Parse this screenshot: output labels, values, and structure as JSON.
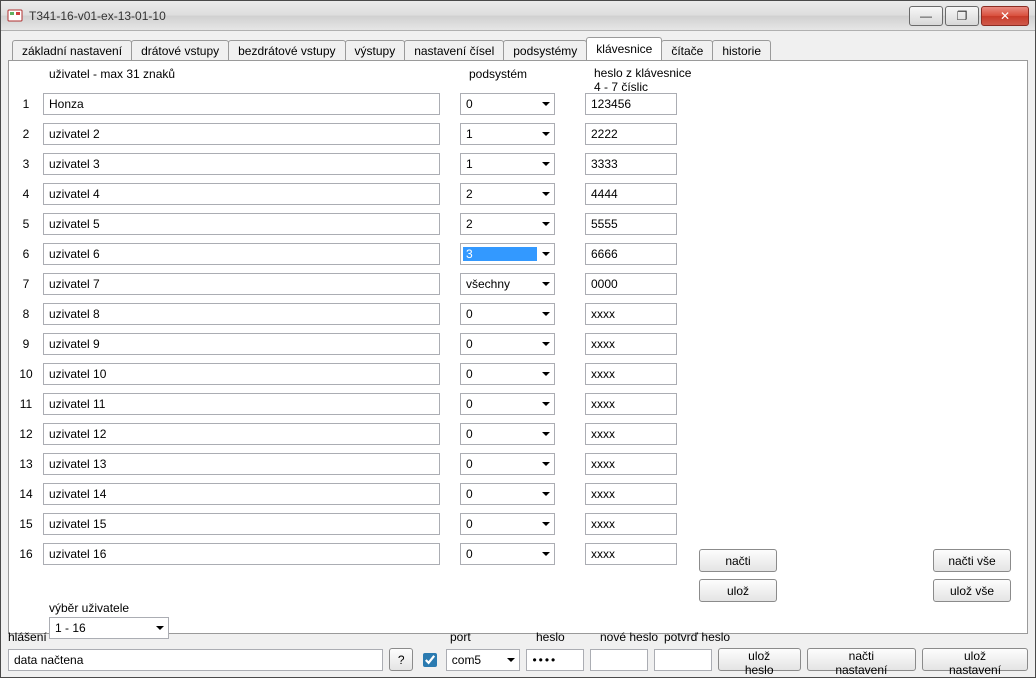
{
  "window": {
    "title": "T341-16-v01-ex-13-01-10"
  },
  "winbuttons": {
    "min": "—",
    "max": "❐",
    "close": "✕"
  },
  "tabs": [
    "základní nastavení",
    "drátové vstupy",
    "bezdrátové vstupy",
    "výstupy",
    "nastavení čísel",
    "podsystémy",
    "klávesnice",
    "čítače",
    "historie"
  ],
  "active_tab_index": 6,
  "headers": {
    "user": "uživatel - max 31 znaků",
    "subsystem": "podsystém",
    "password_line1": "heslo z klávesnice",
    "password_line2": "4 - 7 číslic"
  },
  "rows": [
    {
      "n": "1",
      "user": "Honza",
      "sub": "0",
      "sub_selected": false,
      "pass": "123456"
    },
    {
      "n": "2",
      "user": "uzivatel 2",
      "sub": "1",
      "sub_selected": false,
      "pass": "2222"
    },
    {
      "n": "3",
      "user": "uzivatel 3",
      "sub": "1",
      "sub_selected": false,
      "pass": "3333"
    },
    {
      "n": "4",
      "user": "uzivatel 4",
      "sub": "2",
      "sub_selected": false,
      "pass": "4444"
    },
    {
      "n": "5",
      "user": "uzivatel 5",
      "sub": "2",
      "sub_selected": false,
      "pass": "5555"
    },
    {
      "n": "6",
      "user": "uzivatel 6",
      "sub": "3",
      "sub_selected": true,
      "pass": "6666"
    },
    {
      "n": "7",
      "user": "uzivatel 7",
      "sub": "všechny",
      "sub_selected": false,
      "pass": "0000"
    },
    {
      "n": "8",
      "user": "uzivatel 8",
      "sub": "0",
      "sub_selected": false,
      "pass": "xxxx"
    },
    {
      "n": "9",
      "user": "uzivatel 9",
      "sub": "0",
      "sub_selected": false,
      "pass": "xxxx"
    },
    {
      "n": "10",
      "user": "uzivatel 10",
      "sub": "0",
      "sub_selected": false,
      "pass": "xxxx"
    },
    {
      "n": "11",
      "user": "uzivatel 11",
      "sub": "0",
      "sub_selected": false,
      "pass": "xxxx"
    },
    {
      "n": "12",
      "user": "uzivatel 12",
      "sub": "0",
      "sub_selected": false,
      "pass": "xxxx"
    },
    {
      "n": "13",
      "user": "uzivatel 13",
      "sub": "0",
      "sub_selected": false,
      "pass": "xxxx"
    },
    {
      "n": "14",
      "user": "uzivatel 14",
      "sub": "0",
      "sub_selected": false,
      "pass": "xxxx"
    },
    {
      "n": "15",
      "user": "uzivatel 15",
      "sub": "0",
      "sub_selected": false,
      "pass": "xxxx"
    },
    {
      "n": "16",
      "user": "uzivatel 16",
      "sub": "0",
      "sub_selected": false,
      "pass": "xxxx"
    }
  ],
  "user_select": {
    "label": "výběr uživatele",
    "value": "1 - 16"
  },
  "side_buttons": {
    "read": "načti",
    "save": "ulož",
    "read_all": "načti vše",
    "save_all": "ulož vše"
  },
  "bottom": {
    "msg_label": "hlášení",
    "msg_value": "data načtena",
    "help": "?",
    "port_label": "port",
    "port_checked": true,
    "port_value": "com5",
    "pass_label": "heslo",
    "pass_value": "••••",
    "newpass_label": "nové heslo",
    "newpass_value": "",
    "confpass_label": "potvrď heslo",
    "confpass_value": "",
    "btn_savepass": "ulož heslo",
    "btn_readcfg": "načti nastavení",
    "btn_savecfg": "ulož nastavení"
  }
}
